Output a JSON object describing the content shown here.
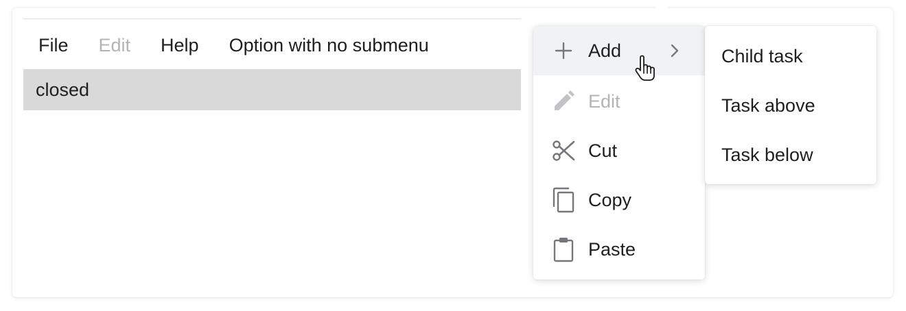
{
  "menubar": {
    "items": [
      {
        "label": "File",
        "disabled": false
      },
      {
        "label": "Edit",
        "disabled": true
      },
      {
        "label": "Help",
        "disabled": false
      },
      {
        "label": "Option with no submenu",
        "disabled": false
      }
    ]
  },
  "status": {
    "text": "closed"
  },
  "context_menu": {
    "items": [
      {
        "label": "Add",
        "icon": "plus-icon",
        "disabled": false,
        "has_submenu": true,
        "active": true
      },
      {
        "label": "Edit",
        "icon": "pencil-icon",
        "disabled": true,
        "has_submenu": false,
        "active": false
      },
      {
        "label": "Cut",
        "icon": "scissors-icon",
        "disabled": false,
        "has_submenu": false,
        "active": false
      },
      {
        "label": "Copy",
        "icon": "copy-icon",
        "disabled": false,
        "has_submenu": false,
        "active": false
      },
      {
        "label": "Paste",
        "icon": "clipboard-icon",
        "disabled": false,
        "has_submenu": false,
        "active": false
      }
    ]
  },
  "submenu": {
    "items": [
      {
        "label": "Child task"
      },
      {
        "label": "Task above"
      },
      {
        "label": "Task below"
      }
    ]
  },
  "colors": {
    "text": "#1f1f1f",
    "disabled_text": "#b4b4b8",
    "icon": "#77777b",
    "icon_disabled": "#c2c2c6",
    "status_bar": "#d9d9d9",
    "active_item": "#f1f2f5"
  }
}
